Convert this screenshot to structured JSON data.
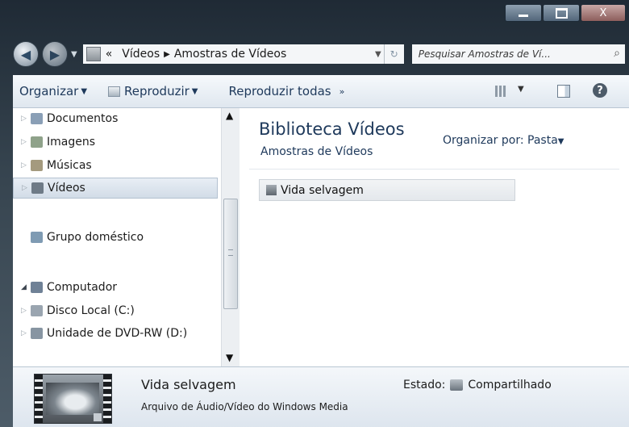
{
  "window": {
    "minimize_icon": "minimize-icon",
    "maximize_icon": "maximize-icon",
    "close_label": "X"
  },
  "address_bar": {
    "prefix": "«",
    "crumbs": [
      "Vídeos",
      "Amostras de Vídeos"
    ],
    "separator": "▶"
  },
  "search": {
    "placeholder": "Pesquisar Amostras de Ví..."
  },
  "toolbar": {
    "organize": "Organizar",
    "play": "Reproduzir",
    "play_all": "Reproduzir todas",
    "more": "»",
    "help": "?"
  },
  "nav_pane": {
    "items": [
      {
        "label": "Documentos",
        "icon": "documents-icon",
        "color": "#8a9fb6"
      },
      {
        "label": "Imagens",
        "icon": "images-icon",
        "color": "#8fa28a"
      },
      {
        "label": "Músicas",
        "icon": "music-icon",
        "color": "#a49a7e"
      },
      {
        "label": "Vídeos",
        "icon": "videos-icon",
        "color": "#6f7b87"
      },
      {
        "label": "Grupo doméstico",
        "icon": "homegroup-icon",
        "color": "#7f9bb3"
      },
      {
        "label": "Computador",
        "icon": "computer-icon",
        "color": "#6f8196"
      },
      {
        "label": "Disco Local (C:)",
        "icon": "local-disk-icon",
        "color": "#9aa5b0"
      },
      {
        "label": "Unidade de DVD-RW (D:)",
        "icon": "dvd-drive-icon",
        "color": "#8795a2"
      }
    ]
  },
  "content": {
    "library_title": "Biblioteca Vídeos",
    "library_subtitle": "Amostras de Vídeos",
    "arrange_by_label": "Organizar por:",
    "arrange_by_value": "Pasta",
    "folder": "Vida selvagem"
  },
  "details": {
    "title": "Vida selvagem",
    "type": "Arquivo de Áudio/Vídeo do Windows Media",
    "state_label": "Estado:",
    "state_value": "Compartilhado"
  },
  "colors": {
    "accent_text": "#1e395b",
    "selected_bg": "#d2dce7"
  }
}
